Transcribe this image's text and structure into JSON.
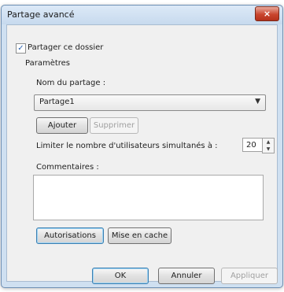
{
  "window": {
    "title": "Partage avancé",
    "close_label": "×"
  },
  "share_checkbox": {
    "label": "Partager ce dossier",
    "checked": true,
    "mark": "✓"
  },
  "settings": {
    "group_label": "Paramètres",
    "share_name_label": "Nom du partage :",
    "share_name_value": "Partage1",
    "add_button": "Ajouter",
    "remove_button": "Supprimer",
    "limit_label": "Limiter le nombre d'utilisateurs simultanés à :",
    "limit_value": "20",
    "comments_label": "Commentaires :",
    "comments_value": "",
    "permissions_button": "Autorisations",
    "caching_button": "Mise en cache"
  },
  "footer": {
    "ok": "OK",
    "cancel": "Annuler",
    "apply": "Appliquer"
  },
  "icons": {
    "combo_arrow": "▼",
    "spin_up": "▲",
    "spin_down": "▼"
  }
}
